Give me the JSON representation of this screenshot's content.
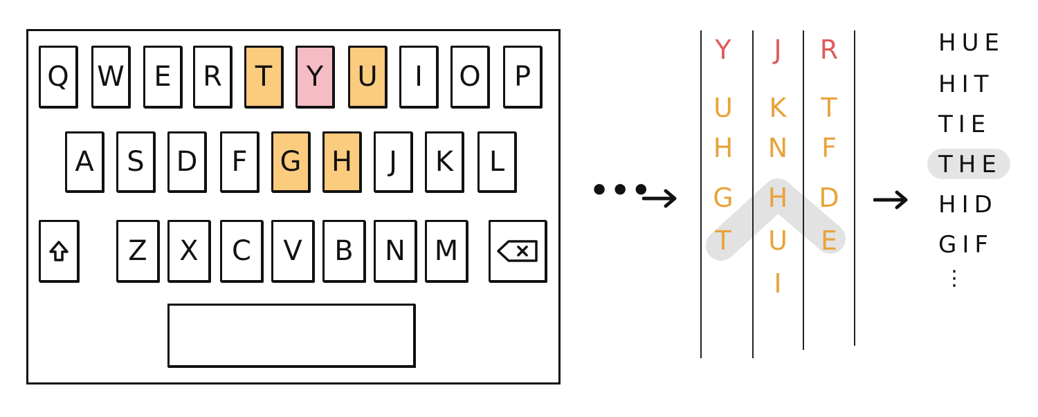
{
  "keyboard": {
    "row1": [
      {
        "label": "Q",
        "hl": ""
      },
      {
        "label": "W",
        "hl": ""
      },
      {
        "label": "E",
        "hl": ""
      },
      {
        "label": "R",
        "hl": ""
      },
      {
        "label": "T",
        "hl": "orange"
      },
      {
        "label": "Y",
        "hl": "pink"
      },
      {
        "label": "U",
        "hl": "orange"
      },
      {
        "label": "I",
        "hl": ""
      },
      {
        "label": "O",
        "hl": ""
      },
      {
        "label": "P",
        "hl": ""
      }
    ],
    "row2": [
      {
        "label": "A",
        "hl": ""
      },
      {
        "label": "S",
        "hl": ""
      },
      {
        "label": "D",
        "hl": ""
      },
      {
        "label": "F",
        "hl": ""
      },
      {
        "label": "G",
        "hl": "orange"
      },
      {
        "label": "H",
        "hl": "orange"
      },
      {
        "label": "J",
        "hl": ""
      },
      {
        "label": "K",
        "hl": ""
      },
      {
        "label": "L",
        "hl": ""
      }
    ],
    "row3": [
      {
        "label": "Z",
        "hl": ""
      },
      {
        "label": "X",
        "hl": ""
      },
      {
        "label": "C",
        "hl": ""
      },
      {
        "label": "V",
        "hl": ""
      },
      {
        "label": "B",
        "hl": ""
      },
      {
        "label": "N",
        "hl": ""
      },
      {
        "label": "M",
        "hl": ""
      }
    ],
    "shift_icon": "shift-arrow-icon",
    "backspace_icon": "backspace-icon",
    "highlight_colors": {
      "orange": "#fbcb7e",
      "pink": "#f6bcc3"
    }
  },
  "ellipsis": "•••",
  "candidates": {
    "columns": [
      {
        "top": "Y",
        "others": [
          "U",
          "H",
          "G",
          "T"
        ]
      },
      {
        "top": "J",
        "others": [
          "K",
          "N",
          "H",
          "U",
          "I"
        ]
      },
      {
        "top": "R",
        "others": [
          "T",
          "F",
          "D",
          "E"
        ]
      }
    ],
    "top_color": "#e05a5a",
    "other_color": "#e8a33a",
    "path_letters": [
      "T",
      "H",
      "E"
    ]
  },
  "words": {
    "list": [
      "HUE",
      "HIT",
      "TIE",
      "THE",
      "HID",
      "GIF"
    ],
    "selected": "THE",
    "more": "⋮"
  }
}
